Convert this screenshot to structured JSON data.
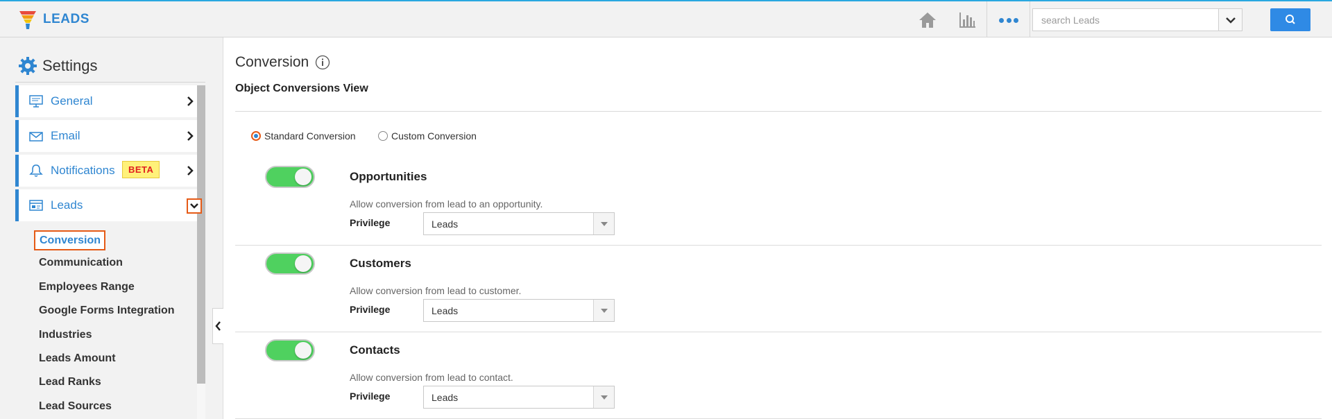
{
  "app": {
    "name": "LEADS"
  },
  "search": {
    "placeholder": "search Leads"
  },
  "colors": {
    "accent": "#2f86d1",
    "highlight": "#e55a16",
    "toggle_on": "#4fd15f",
    "top_border": "#29a8e0"
  },
  "sidebar": {
    "title": "Settings",
    "items": [
      {
        "label": "General",
        "icon": "monitor-icon"
      },
      {
        "label": "Email",
        "icon": "envelope-icon"
      },
      {
        "label": "Notifications",
        "icon": "bell-icon",
        "badge": "BETA"
      },
      {
        "label": "Leads",
        "icon": "leads-icon"
      }
    ],
    "subitems": [
      "Conversion",
      "Communication",
      "Employees Range",
      "Google Forms Integration",
      "Industries",
      "Leads Amount",
      "Lead Ranks",
      "Lead Sources"
    ]
  },
  "main": {
    "title": "Conversion",
    "section_title": "Object Conversions View",
    "radio": {
      "standard": "Standard Conversion",
      "custom": "Custom Conversion",
      "selected": "standard"
    },
    "privilege_label": "Privilege",
    "conversions": [
      {
        "name": "Opportunities",
        "desc": "Allow conversion from lead to an opportunity.",
        "privilege": "Leads",
        "enabled": true
      },
      {
        "name": "Customers",
        "desc": "Allow conversion from lead to customer.",
        "privilege": "Leads",
        "enabled": true
      },
      {
        "name": "Contacts",
        "desc": "Allow conversion from lead to contact.",
        "privilege": "Leads",
        "enabled": true
      }
    ]
  }
}
